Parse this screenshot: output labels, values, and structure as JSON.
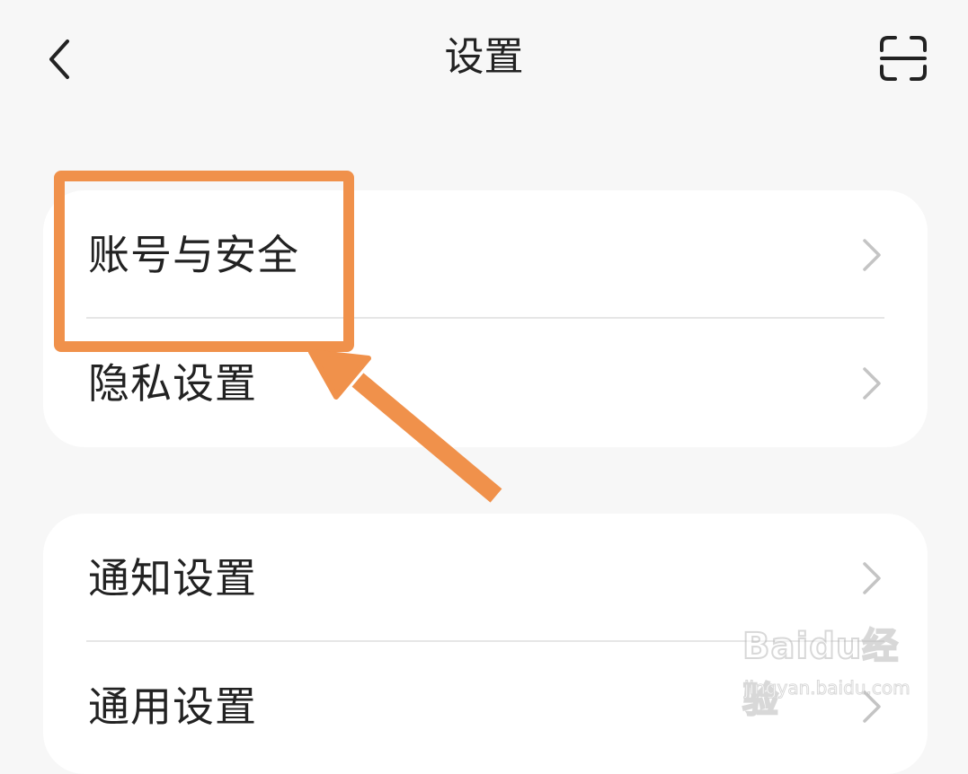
{
  "header": {
    "title": "设置",
    "back_icon": "chevron-left-icon",
    "scan_icon": "scan-icon"
  },
  "groups": [
    {
      "items": [
        {
          "label": "账号与安全",
          "icon": "chevron-right-icon"
        },
        {
          "label": "隐私设置",
          "icon": "chevron-right-icon"
        }
      ]
    },
    {
      "items": [
        {
          "label": "通知设置",
          "icon": "chevron-right-icon"
        },
        {
          "label": "通用设置",
          "icon": "chevron-right-icon"
        }
      ]
    }
  ],
  "annotation": {
    "color": "#f0914b"
  },
  "watermark": {
    "logo": "Baidu经验",
    "url": "jingyan.baidu.com"
  },
  "colors": {
    "background": "#f7f7f7",
    "card": "#ffffff",
    "text": "#222222",
    "chevron": "#c4c4c4",
    "divider": "#e6e6e6"
  }
}
